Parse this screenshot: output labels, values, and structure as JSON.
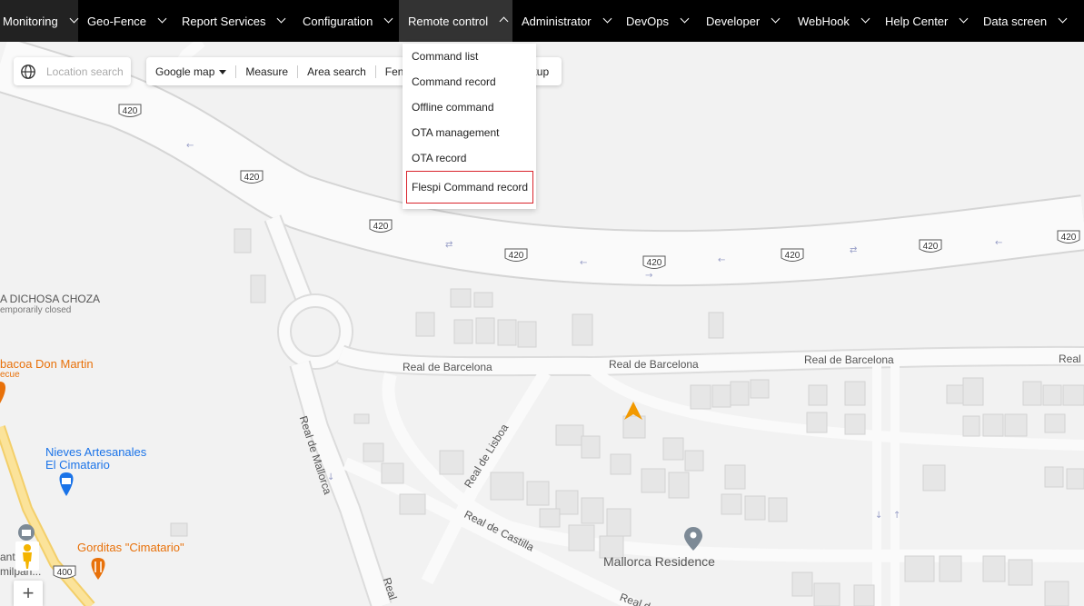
{
  "nav": {
    "items": [
      {
        "label": "Monitoring"
      },
      {
        "label": "Geo-Fence"
      },
      {
        "label": "Report Services"
      },
      {
        "label": "Configuration"
      },
      {
        "label": "Remote control"
      },
      {
        "label": "Administrator"
      },
      {
        "label": "DevOps"
      },
      {
        "label": "Developer"
      },
      {
        "label": "WebHook"
      },
      {
        "label": "Help Center"
      },
      {
        "label": "Data screen"
      }
    ]
  },
  "dropdown": {
    "items": [
      {
        "label": "Command list"
      },
      {
        "label": "Command record"
      },
      {
        "label": "Offline command"
      },
      {
        "label": "OTA management"
      },
      {
        "label": "OTA record"
      },
      {
        "label": "Flespi Command record"
      }
    ]
  },
  "search": {
    "placeholder": "Location search"
  },
  "toolbar": {
    "map_type": "Google map",
    "measure": "Measure",
    "area_search": "Area search",
    "fence_partial": "Fen",
    "hidden_partial": "kup"
  },
  "map": {
    "route_shields": [
      "420",
      "420",
      "420",
      "420",
      "420",
      "420",
      "420",
      "420",
      "420",
      "400"
    ],
    "pois": {
      "la_dichosa": "A DICHOSA CHOZA",
      "la_dichosa_status": "emporarily closed",
      "barbacoa": "bacoa Don Martin",
      "barbacoa_sub": "ecue",
      "nieves_line1": "Nieves Artesanales",
      "nieves_line2": "El Cimatario",
      "gorditas": "Gorditas \"Cimatario\"",
      "mallorca": "Mallorca Residence",
      "left_partial1": "ant",
      "left_partial2": "milpan..."
    },
    "streets": {
      "barcelona_1": "Real de Barcelona",
      "barcelona_2": "Real de Barcelona",
      "barcelona_3": "Real de Barcelona",
      "barcelona_4": "Real",
      "mallorca": "Real de Mallorca",
      "lisboa": "Real de Lisboa",
      "castilla": "Real de Castilla",
      "bottom_partial1": "Real",
      "bottom_partial2": "Real de"
    }
  },
  "zoom": {
    "plus": "+"
  },
  "colors": {
    "nav_bg": "#000000",
    "highlight_border": "#d9232b",
    "poi_orange": "#e8710a",
    "poi_blue": "#1a73e8",
    "vehicle": "#f29900"
  }
}
